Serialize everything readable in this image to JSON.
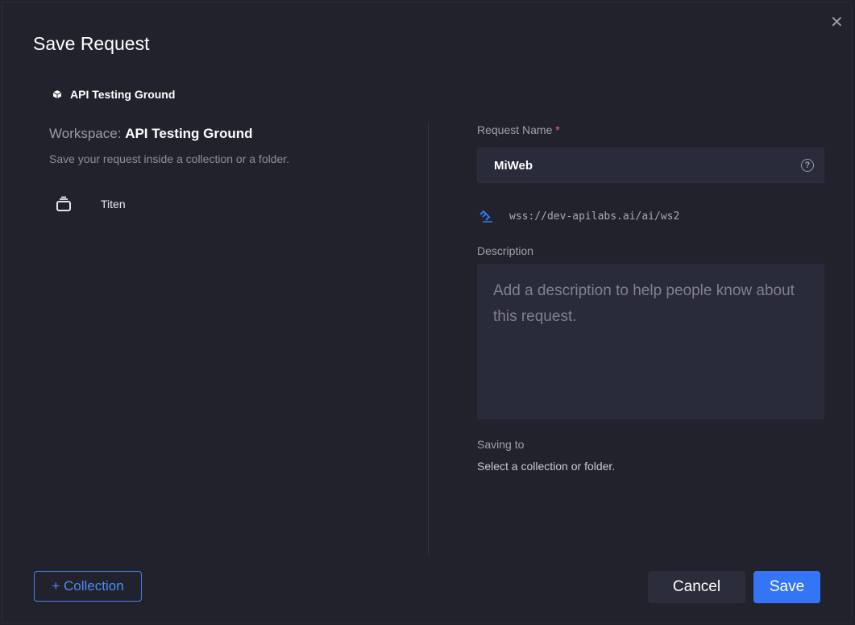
{
  "dialog": {
    "title": "Save Request",
    "close_icon": "close-icon"
  },
  "left": {
    "workspace_chip": "API Testing Ground",
    "workspace_label": "Workspace:",
    "workspace_name": "API Testing Ground",
    "hint": "Save your request inside a collection or a folder.",
    "collections": [
      {
        "name": "Titen",
        "icon": "collection-icon"
      }
    ],
    "add_collection": "+ Collection"
  },
  "right": {
    "request_name_label": "Request Name",
    "required_mark": "*",
    "request_name_value": "MiWeb",
    "help_icon": "?",
    "url": "wss://dev-apilabs.ai/ai/ws2",
    "description_label": "Description",
    "description_placeholder": "Add a description to help people know about this request.",
    "saving_to_label": "Saving to",
    "saving_to_value": "Select a collection or folder."
  },
  "footer": {
    "cancel": "Cancel",
    "save": "Save"
  },
  "colors": {
    "accent": "#3475f5",
    "background": "#22222d",
    "required": "#f06a7a"
  }
}
